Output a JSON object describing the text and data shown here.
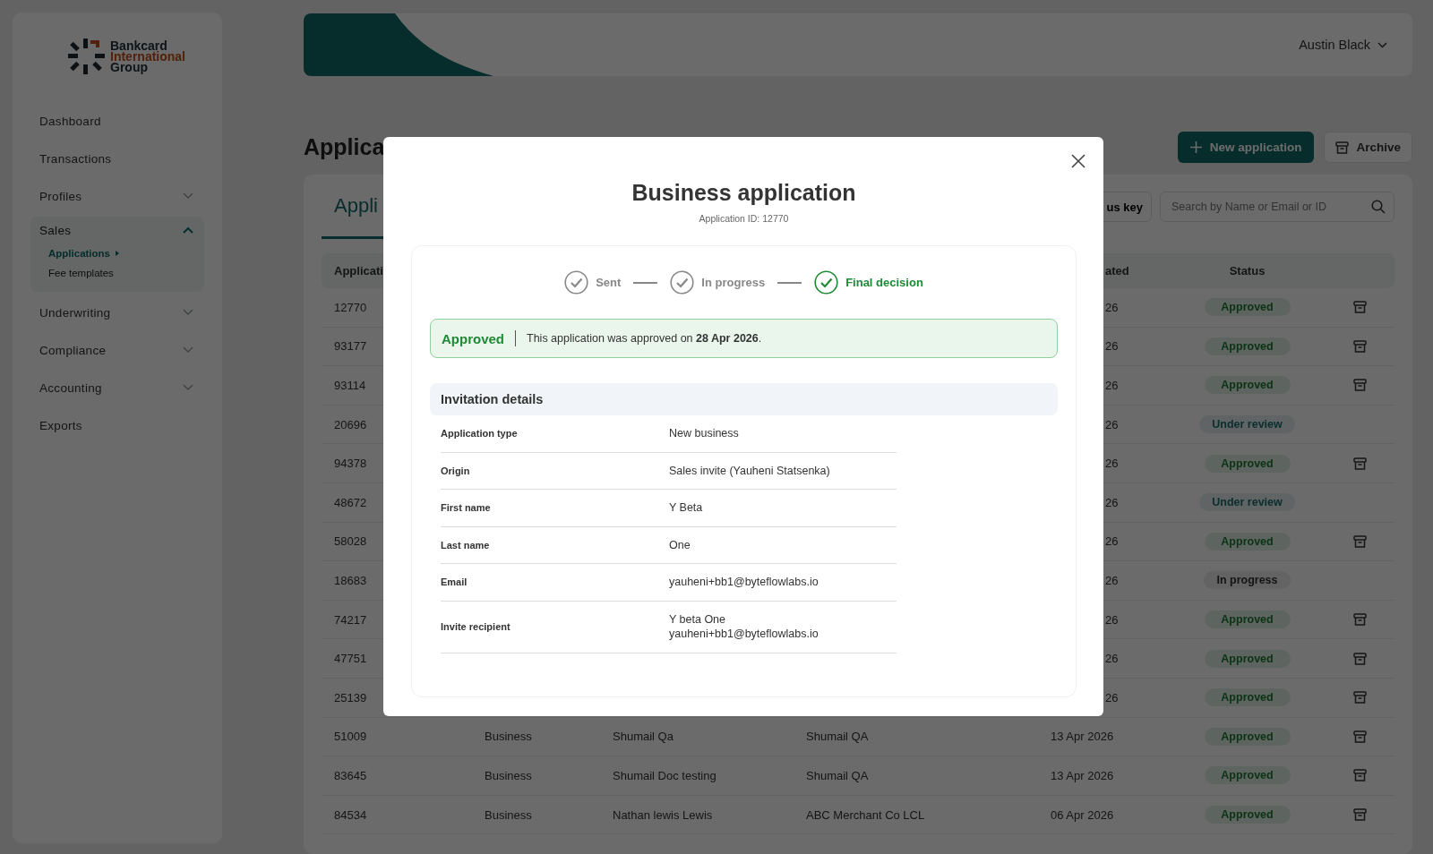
{
  "logo": {
    "line_1": "Bankcard",
    "line_2": "International",
    "line_3": "Group"
  },
  "sidebar": {
    "items": [
      {
        "label": "Dashboard"
      },
      {
        "label": "Transactions"
      },
      {
        "label": "Profiles",
        "expanded": false
      },
      {
        "label": "Sales",
        "expanded": true,
        "children": [
          {
            "label": "Applications",
            "selected": true
          },
          {
            "label": "Fee templates",
            "selected": false
          }
        ]
      },
      {
        "label": "Underwriting",
        "expanded": false
      },
      {
        "label": "Compliance",
        "expanded": false
      },
      {
        "label": "Accounting",
        "expanded": false
      },
      {
        "label": "Exports"
      }
    ]
  },
  "header": {
    "user": "Austin Black"
  },
  "page": {
    "title": "Applica",
    "new_button": "New application",
    "archive_button": "Archive"
  },
  "tabs": [
    {
      "label": "Appli",
      "selected": true
    }
  ],
  "status_key_button": "us key",
  "search": {
    "placeholder": "Search by Name or Email or ID"
  },
  "table": {
    "columns": [
      "Applicati",
      "",
      "",
      "",
      "ated",
      "Status"
    ],
    "rows": [
      {
        "id": "12770",
        "date": "26",
        "status": "Approved",
        "kind": "approved",
        "archive_icon": true
      },
      {
        "id": "93177",
        "date": "26",
        "status": "Approved",
        "kind": "approved",
        "archive_icon": true
      },
      {
        "id": "93114",
        "date": "26",
        "status": "Approved",
        "kind": "approved",
        "archive_icon": true
      },
      {
        "id": "20696",
        "date": "26",
        "status": "Under review",
        "kind": "review",
        "archive_icon": false
      },
      {
        "id": "94378",
        "date": "26",
        "status": "Approved",
        "kind": "approved",
        "archive_icon": true
      },
      {
        "id": "48672",
        "date": "26",
        "status": "Under review",
        "kind": "review",
        "archive_icon": false
      },
      {
        "id": "58028",
        "date": "26",
        "status": "Approved",
        "kind": "approved",
        "archive_icon": true
      },
      {
        "id": "18683",
        "date": "26",
        "status": "In progress",
        "kind": "progress",
        "archive_icon": false
      },
      {
        "id": "74217",
        "date": "26",
        "status": "Approved",
        "kind": "approved",
        "archive_icon": true
      },
      {
        "id": "47751",
        "date": "26",
        "status": "Approved",
        "kind": "approved",
        "archive_icon": true
      },
      {
        "id": "25139",
        "date": "26",
        "status": "Approved",
        "kind": "approved",
        "archive_icon": true
      },
      {
        "id": "51009",
        "type": "Business",
        "name": "Shumail Qa",
        "company": "Shumail QA",
        "date": "13 Apr 2026",
        "status": "Approved",
        "kind": "approved",
        "archive_icon": true
      },
      {
        "id": "83645",
        "type": "Business",
        "name": "Shumail Doc testing",
        "company": "Shumail QA",
        "date": "13 Apr 2026",
        "status": "Approved",
        "kind": "approved",
        "archive_icon": true
      },
      {
        "id": "84534",
        "type": "Business",
        "name": "Nathan lewis Lewis",
        "company": "ABC Merchant Co LCL",
        "date": "06 Apr 2026",
        "status": "Approved",
        "kind": "approved",
        "archive_icon": true
      }
    ]
  },
  "modal": {
    "title": "Business application",
    "subtitle": "Application ID: 12770",
    "steps": [
      {
        "label": "Sent",
        "current": false
      },
      {
        "label": "In progress",
        "current": false
      },
      {
        "label": "Final decision",
        "current": true
      }
    ],
    "alert": {
      "status": "Approved",
      "text": "This application was approved on **28 Apr 2026**."
    },
    "section_title": "Invitation details",
    "details": [
      {
        "label": "Application type",
        "values": [
          "New business"
        ]
      },
      {
        "label": "Origin",
        "values": [
          "Sales invite (Yauheni Statsenka)"
        ]
      },
      {
        "label": "First name",
        "values": [
          "Y Beta"
        ]
      },
      {
        "label": "Last name",
        "values": [
          "One"
        ]
      },
      {
        "label": "Email",
        "values": [
          "yauheni+bb1@byteflowlabs.io"
        ]
      },
      {
        "label": "Invite recipient",
        "values": [
          "Y beta One",
          "yauheni+bb1@byteflowlabs.io"
        ]
      }
    ]
  }
}
